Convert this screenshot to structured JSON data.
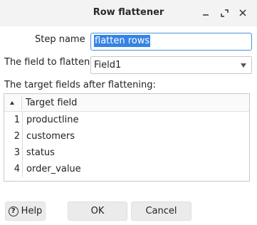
{
  "window": {
    "title": "Row flattener"
  },
  "form": {
    "step_name_label": "Step name",
    "step_name_value": "flatten rows",
    "field_to_flatten_label": "The field to flatten",
    "field_to_flatten_value": "Field1",
    "target_fields_label": "The target fields after flattening:"
  },
  "table": {
    "column_header": "Target field",
    "rows": [
      {
        "num": "1",
        "value": "productline"
      },
      {
        "num": "2",
        "value": "customers"
      },
      {
        "num": "3",
        "value": "status"
      },
      {
        "num": "4",
        "value": "order_value"
      }
    ]
  },
  "buttons": {
    "help": "Help",
    "ok": "OK",
    "cancel": "Cancel"
  },
  "icons": {
    "minimize": "minimize-icon",
    "maximize": "maximize-icon",
    "close": "close-icon",
    "dropdown": "chevron-down-icon",
    "sort": "sort-ascending-icon",
    "help": "help-icon"
  },
  "colors": {
    "selection": "#3584e4",
    "focus_border": "#4a90d9"
  }
}
